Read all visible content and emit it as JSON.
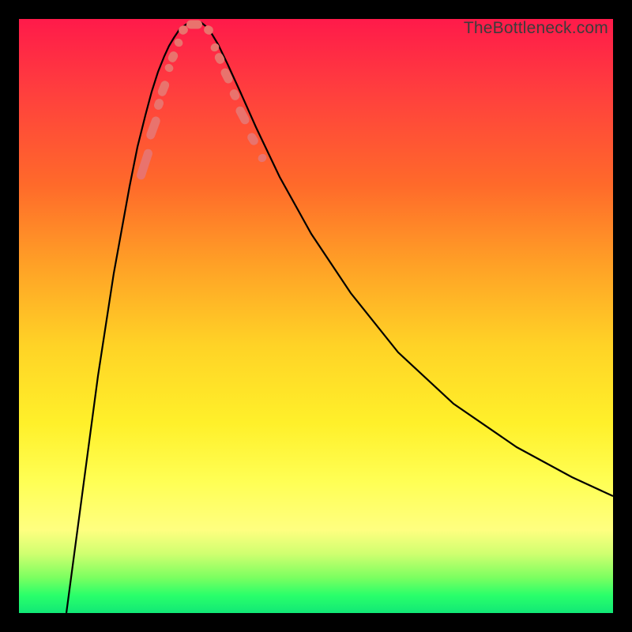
{
  "watermark": "TheBottleneck.com",
  "colors": {
    "tick_fill": "#e9736d",
    "curve_stroke": "#000000"
  },
  "chart_data": {
    "type": "line",
    "title": "",
    "xlabel": "",
    "ylabel": "",
    "xlim": [
      0,
      752
    ],
    "ylim": [
      0,
      752
    ],
    "legend": false,
    "grid": false,
    "annotations": [
      "TheBottleneck.com"
    ],
    "series": [
      {
        "name": "left-curve",
        "x": [
          60,
          80,
          100,
          120,
          140,
          150,
          160,
          168,
          176,
          184,
          190,
          196,
          204,
          216
        ],
        "y": [
          0,
          150,
          300,
          430,
          540,
          590,
          630,
          660,
          685,
          705,
          718,
          728,
          740,
          748
        ]
      },
      {
        "name": "right-curve",
        "x": [
          230,
          240,
          252,
          264,
          280,
          300,
          330,
          370,
          420,
          480,
          550,
          630,
          700,
          752
        ],
        "y": [
          748,
          740,
          720,
          695,
          660,
          615,
          552,
          480,
          405,
          330,
          265,
          210,
          172,
          148
        ]
      }
    ],
    "ticks": {
      "comment": "salmon rounded markers along the curves near the trough",
      "left": [
        {
          "x": 159,
          "y": 568,
          "len": 40,
          "angle": -72
        },
        {
          "x": 170,
          "y": 614,
          "len": 30,
          "angle": -70
        },
        {
          "x": 177,
          "y": 644,
          "len": 14,
          "angle": -70
        },
        {
          "x": 183,
          "y": 664,
          "len": 20,
          "angle": -68
        },
        {
          "x": 190,
          "y": 690,
          "len": 10,
          "angle": -65
        },
        {
          "x": 195,
          "y": 704,
          "len": 14,
          "angle": -62
        },
        {
          "x": 202,
          "y": 722,
          "len": 10,
          "angle": -55
        }
      ],
      "right": [
        {
          "x": 248,
          "y": 716,
          "len": 10,
          "angle": 60
        },
        {
          "x": 254,
          "y": 702,
          "len": 14,
          "angle": 62
        },
        {
          "x": 263,
          "y": 680,
          "len": 20,
          "angle": 63
        },
        {
          "x": 273,
          "y": 656,
          "len": 14,
          "angle": 63
        },
        {
          "x": 283,
          "y": 630,
          "len": 24,
          "angle": 62
        },
        {
          "x": 296,
          "y": 600,
          "len": 16,
          "angle": 58
        },
        {
          "x": 308,
          "y": 576,
          "len": 10,
          "angle": 55
        }
      ],
      "bottom": [
        {
          "x": 208,
          "y": 738,
          "len": 12,
          "angle": -25
        },
        {
          "x": 222,
          "y": 745,
          "len": 20,
          "angle": 0
        },
        {
          "x": 240,
          "y": 738,
          "len": 12,
          "angle": 30
        }
      ]
    }
  }
}
